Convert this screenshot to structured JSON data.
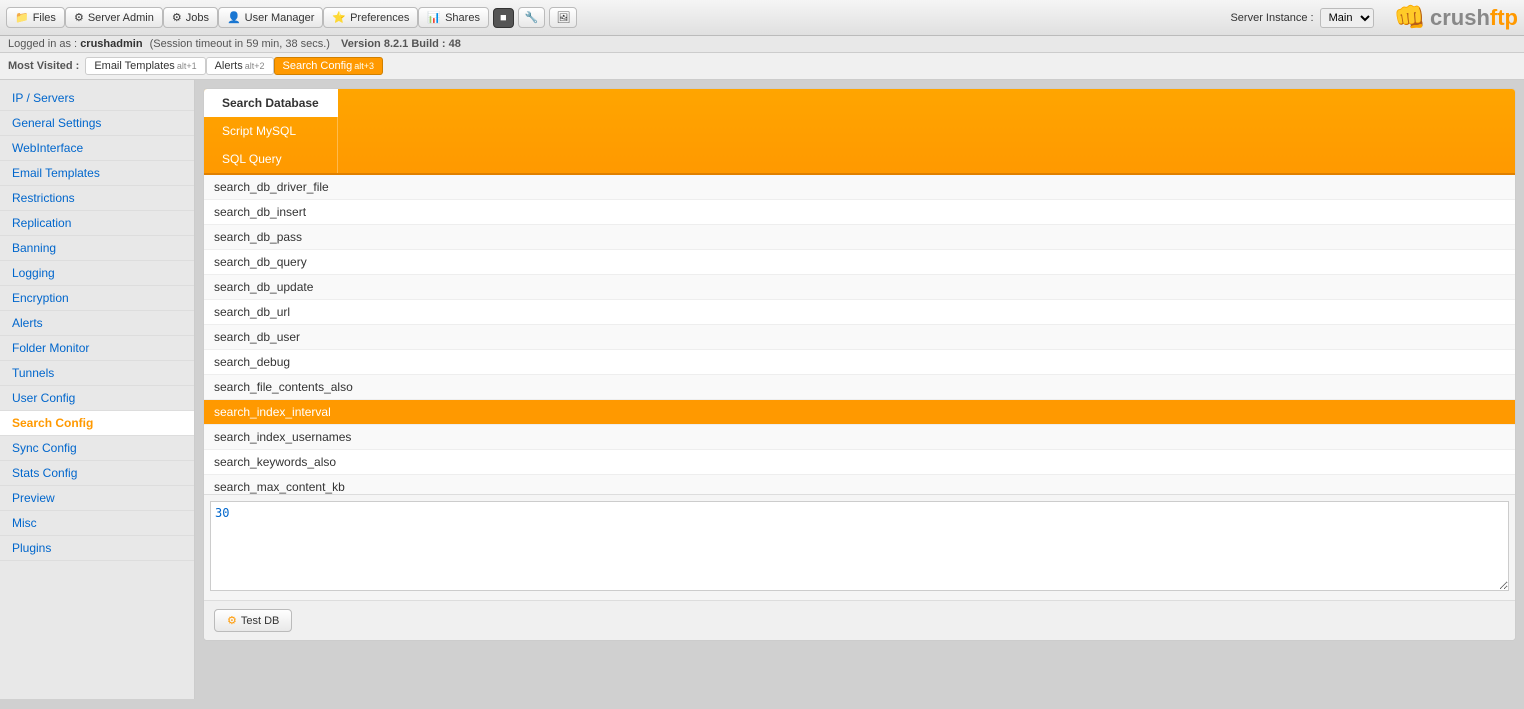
{
  "topnav": {
    "buttons": [
      {
        "id": "files",
        "label": "Files",
        "icon": "📁"
      },
      {
        "id": "server-admin",
        "label": "Server Admin",
        "icon": "⚙"
      },
      {
        "id": "jobs",
        "label": "Jobs",
        "icon": "⚙"
      },
      {
        "id": "user-manager",
        "label": "User Manager",
        "icon": "👤"
      },
      {
        "id": "preferences",
        "label": "Preferences",
        "icon": "⭐"
      },
      {
        "id": "shares",
        "label": "Shares",
        "icon": "📊"
      }
    ],
    "extra_icons": [
      "■",
      "🔧",
      "🖼"
    ],
    "server_instance_label": "Server Instance :",
    "server_instance_value": "Main"
  },
  "status_bar": {
    "text": "Logged in as :",
    "username": "crushadmin",
    "session": "(Session timeout in 59 min, 38 secs.)",
    "version": "Version 8.2.1 Build : 48"
  },
  "bookmarks": {
    "label": "Most Visited :",
    "items": [
      {
        "id": "email-templates",
        "label": "Email Templates",
        "shortcut": "alt+1",
        "active": false
      },
      {
        "id": "alerts",
        "label": "Alerts",
        "shortcut": "alt+2",
        "active": false
      },
      {
        "id": "search-config",
        "label": "Search Config",
        "shortcut": "alt+3",
        "active": true
      }
    ]
  },
  "sidebar": {
    "items": [
      {
        "id": "ip-servers",
        "label": "IP / Servers",
        "active": false
      },
      {
        "id": "general-settings",
        "label": "General Settings",
        "active": false
      },
      {
        "id": "webinterface",
        "label": "WebInterface",
        "active": false
      },
      {
        "id": "email-templates",
        "label": "Email Templates",
        "active": false
      },
      {
        "id": "restrictions",
        "label": "Restrictions",
        "active": false
      },
      {
        "id": "replication",
        "label": "Replication",
        "active": false
      },
      {
        "id": "banning",
        "label": "Banning",
        "active": false
      },
      {
        "id": "logging",
        "label": "Logging",
        "active": false
      },
      {
        "id": "encryption",
        "label": "Encryption",
        "active": false
      },
      {
        "id": "alerts",
        "label": "Alerts",
        "active": false
      },
      {
        "id": "folder-monitor",
        "label": "Folder Monitor",
        "active": false
      },
      {
        "id": "tunnels",
        "label": "Tunnels",
        "active": false
      },
      {
        "id": "user-config",
        "label": "User Config",
        "active": false
      },
      {
        "id": "search-config",
        "label": "Search Config",
        "active": true
      },
      {
        "id": "sync-config",
        "label": "Sync Config",
        "active": false
      },
      {
        "id": "stats-config",
        "label": "Stats Config",
        "active": false
      },
      {
        "id": "preview",
        "label": "Preview",
        "active": false
      },
      {
        "id": "misc",
        "label": "Misc",
        "active": false
      },
      {
        "id": "plugins",
        "label": "Plugins",
        "active": false
      }
    ]
  },
  "tabs": [
    {
      "id": "search-database",
      "label": "Search Database",
      "active": true
    },
    {
      "id": "script-mysql",
      "label": "Script MySQL",
      "active": false
    },
    {
      "id": "sql-query",
      "label": "SQL Query",
      "active": false
    }
  ],
  "list_items": [
    {
      "id": "search_db_driver_file",
      "label": "search_db_driver_file",
      "selected": false
    },
    {
      "id": "search_db_insert",
      "label": "search_db_insert",
      "selected": false
    },
    {
      "id": "search_db_pass",
      "label": "search_db_pass",
      "selected": false
    },
    {
      "id": "search_db_query",
      "label": "search_db_query",
      "selected": false
    },
    {
      "id": "search_db_update",
      "label": "search_db_update",
      "selected": false
    },
    {
      "id": "search_db_url",
      "label": "search_db_url",
      "selected": false
    },
    {
      "id": "search_db_user",
      "label": "search_db_user",
      "selected": false
    },
    {
      "id": "search_debug",
      "label": "search_debug",
      "selected": false
    },
    {
      "id": "search_file_contents_also",
      "label": "search_file_contents_also",
      "selected": false
    },
    {
      "id": "search_index_interval",
      "label": "search_index_interval",
      "selected": true
    },
    {
      "id": "search_index_usernames",
      "label": "search_index_usernames",
      "selected": false
    },
    {
      "id": "search_keywords_also",
      "label": "search_keywords_also",
      "selected": false
    },
    {
      "id": "search_max_content_kb",
      "label": "search_max_content_kb",
      "selected": false
    }
  ],
  "value_editor": {
    "value": "30"
  },
  "footer": {
    "test_db_label": "Test DB"
  },
  "logo": {
    "fist": "👊",
    "text_gray": "crush",
    "text_orange": "ftp"
  }
}
